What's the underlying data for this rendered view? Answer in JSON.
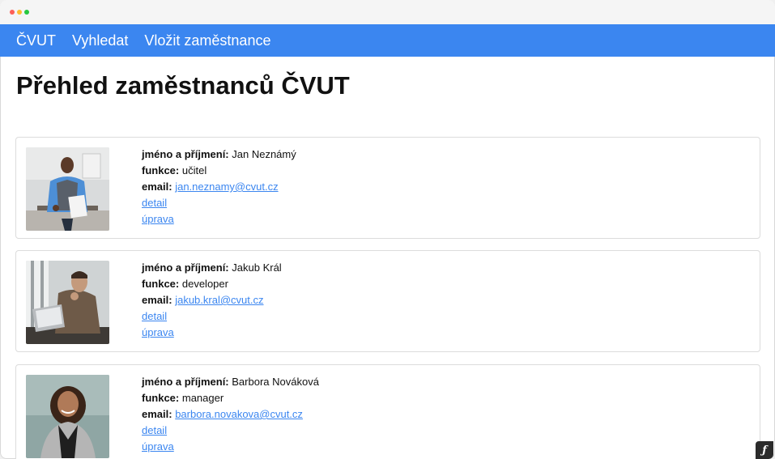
{
  "navbar": {
    "brand": "ČVUT",
    "links": [
      "Vyhledat",
      "Vložit zaměstnance"
    ],
    "color": "#3b86f0"
  },
  "page": {
    "title": "Přehled zaměstnanců ČVUT"
  },
  "labels": {
    "name": "jméno a příjmení:",
    "function": "funkce:",
    "email": "email:",
    "detail": "detail",
    "edit": "úprava"
  },
  "employees": [
    {
      "name": "Jan Neznámý",
      "function": "učitel",
      "email": "jan.neznamy@cvut.cz",
      "photo": "man-presenting-photo"
    },
    {
      "name": "Jakub Král",
      "function": "developer",
      "email": "jakub.kral@cvut.cz",
      "photo": "man-laptop-photo"
    },
    {
      "name": "Barbora Nováková",
      "function": "manager",
      "email": "barbora.novakova@cvut.cz",
      "photo": "woman-portrait-photo"
    }
  ],
  "badge": {
    "icon": "symfony-toolbar-icon"
  }
}
